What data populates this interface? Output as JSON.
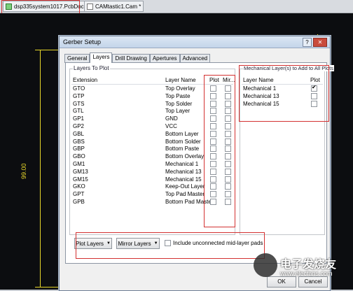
{
  "file_tabs": [
    {
      "label": "dsp335system1017.PcbDoc"
    },
    {
      "label": "CAMtastic1.Cam *"
    }
  ],
  "workspace": {
    "dimension_label": "99.00"
  },
  "dialog": {
    "title": "Gerber Setup",
    "help_label": "?",
    "close_label": "✕",
    "tabs": [
      {
        "label": "General"
      },
      {
        "label": "Layers"
      },
      {
        "label": "Drill Drawing"
      },
      {
        "label": "Apertures"
      },
      {
        "label": "Advanced"
      }
    ],
    "layers_to_plot": {
      "group_title": "Layers To Plot",
      "columns": {
        "extension": "Extension",
        "layer_name": "Layer Name",
        "plot": "Plot",
        "mirror": "Mir..."
      },
      "rows": [
        {
          "ext": "GTO",
          "name": "Top Overlay"
        },
        {
          "ext": "GTP",
          "name": "Top Paste"
        },
        {
          "ext": "GTS",
          "name": "Top Solder"
        },
        {
          "ext": "GTL",
          "name": "Top Layer"
        },
        {
          "ext": "GP1",
          "name": "GND"
        },
        {
          "ext": "GP2",
          "name": "VCC"
        },
        {
          "ext": "GBL",
          "name": "Bottom Layer"
        },
        {
          "ext": "GBS",
          "name": "Bottom Solder"
        },
        {
          "ext": "GBP",
          "name": "Bottom Paste"
        },
        {
          "ext": "GBO",
          "name": "Bottom Overlay"
        },
        {
          "ext": "GM1",
          "name": "Mechanical 1"
        },
        {
          "ext": "GM13",
          "name": "Mechanical 13"
        },
        {
          "ext": "GM15",
          "name": "Mechanical 15"
        },
        {
          "ext": "GKO",
          "name": "Keep-Out Layer"
        },
        {
          "ext": "GPT",
          "name": "Top Pad Master"
        },
        {
          "ext": "GPB",
          "name": "Bottom Pad Maste"
        }
      ]
    },
    "mechanical": {
      "group_title": "Mechanical Layer(s) to Add to All Plots",
      "columns": {
        "layer_name": "Layer Name",
        "plot": "Plot"
      },
      "rows": [
        {
          "name": "Mechanical 1",
          "checked": true
        },
        {
          "name": "Mechanical 13",
          "checked": false
        },
        {
          "name": "Mechanical 15",
          "checked": false
        }
      ]
    },
    "plot_layers_button": "Plot Layers",
    "mirror_layers_button": "Mirror Layers",
    "include_mid_layer_label": "Include unconnected mid-layer pads",
    "ok_button": "OK",
    "cancel_button": "Cancel"
  },
  "watermark": {
    "title": "电子发烧友",
    "url": "www.elecfans.com"
  }
}
